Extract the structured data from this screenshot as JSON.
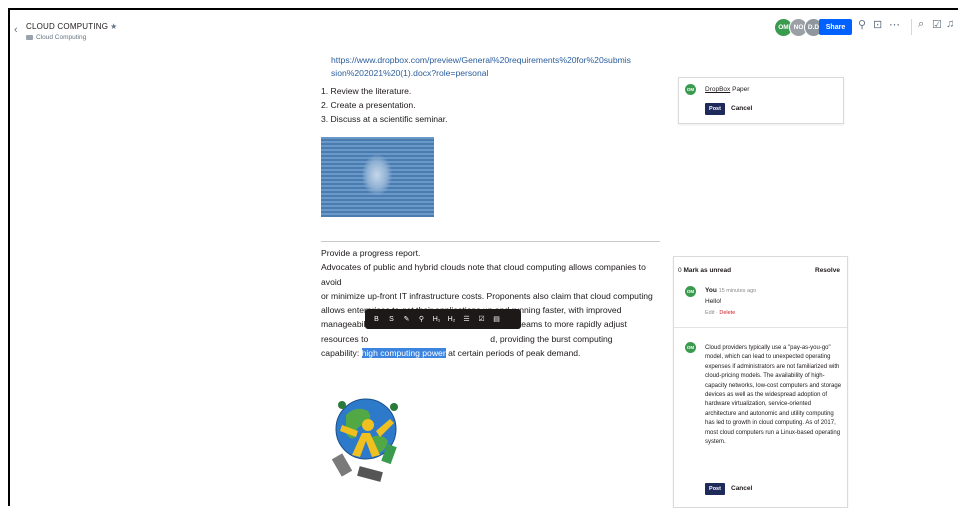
{
  "header": {
    "title": "CLOUD COMPUTING",
    "folder": "Cloud Computing",
    "avatars": [
      {
        "initials": "OM",
        "color": "#3a9b4e"
      },
      {
        "initials": "NO",
        "color": "#9aa0a6"
      },
      {
        "initials": "D.D",
        "color": "#8f969d"
      }
    ],
    "share_label": "Share"
  },
  "doc": {
    "link": "https://www.dropbox.com/preview/General%20requirements%20for%20submission%202021%20(1).docx?role=personal",
    "list": [
      "1.  Review the literature.",
      "2.  Create a presentation.",
      "3.  Discuss at a scientific seminar."
    ],
    "progress": "Provide a progress report.",
    "para_line1": "Advocates of public and hybrid clouds note that cloud computing allows companies to avoid",
    "para_line2": "or minimize up-front IT infrastructure costs. Proponents also claim that cloud computing",
    "para_line3": "allows enterprises to get their applications up and running faster, with improved",
    "para_line4_a": "manageabili",
    "para_line4_b": "s IT teams to more rapidly adjust",
    "para_line5_a": "resources to",
    "para_line5_b": "d, providing the burst computing",
    "para_line6_a": "capability: ",
    "para_highlight": "high computing power",
    "para_line6_b": " at certain periods of peak demand."
  },
  "format_toolbar": [
    "B",
    "S",
    "✎",
    "⚲",
    "H₁",
    "H₂",
    "☰",
    "☑",
    "▤"
  ],
  "comment1": {
    "avatar": "OM",
    "link_text": "DropBox",
    "text": " Paper",
    "post": "Post",
    "cancel": "Cancel"
  },
  "thread": {
    "unread": "Mark as unread",
    "unread_prefix": "0",
    "resolve": "Resolve",
    "author": "You",
    "time": "15 minutes ago",
    "message": "Hello!",
    "edit": "Edit",
    "delete": "Delete",
    "reply_avatar": "OM",
    "reply_text": "Cloud providers typically use a \"pay-as-you-go\" model, which can lead to unexpected operating expenses if administrators are not familiarized with cloud-pricing models. The availability of high-capacity networks, low-cost computers and storage devices as well as the widespread adoption of hardware virtualization, service-oriented architecture and autonomic and utility computing has led to growth in cloud computing. As of 2017, most cloud computers run a Linux-based operating system.",
    "post": "Post",
    "cancel": "Cancel"
  }
}
